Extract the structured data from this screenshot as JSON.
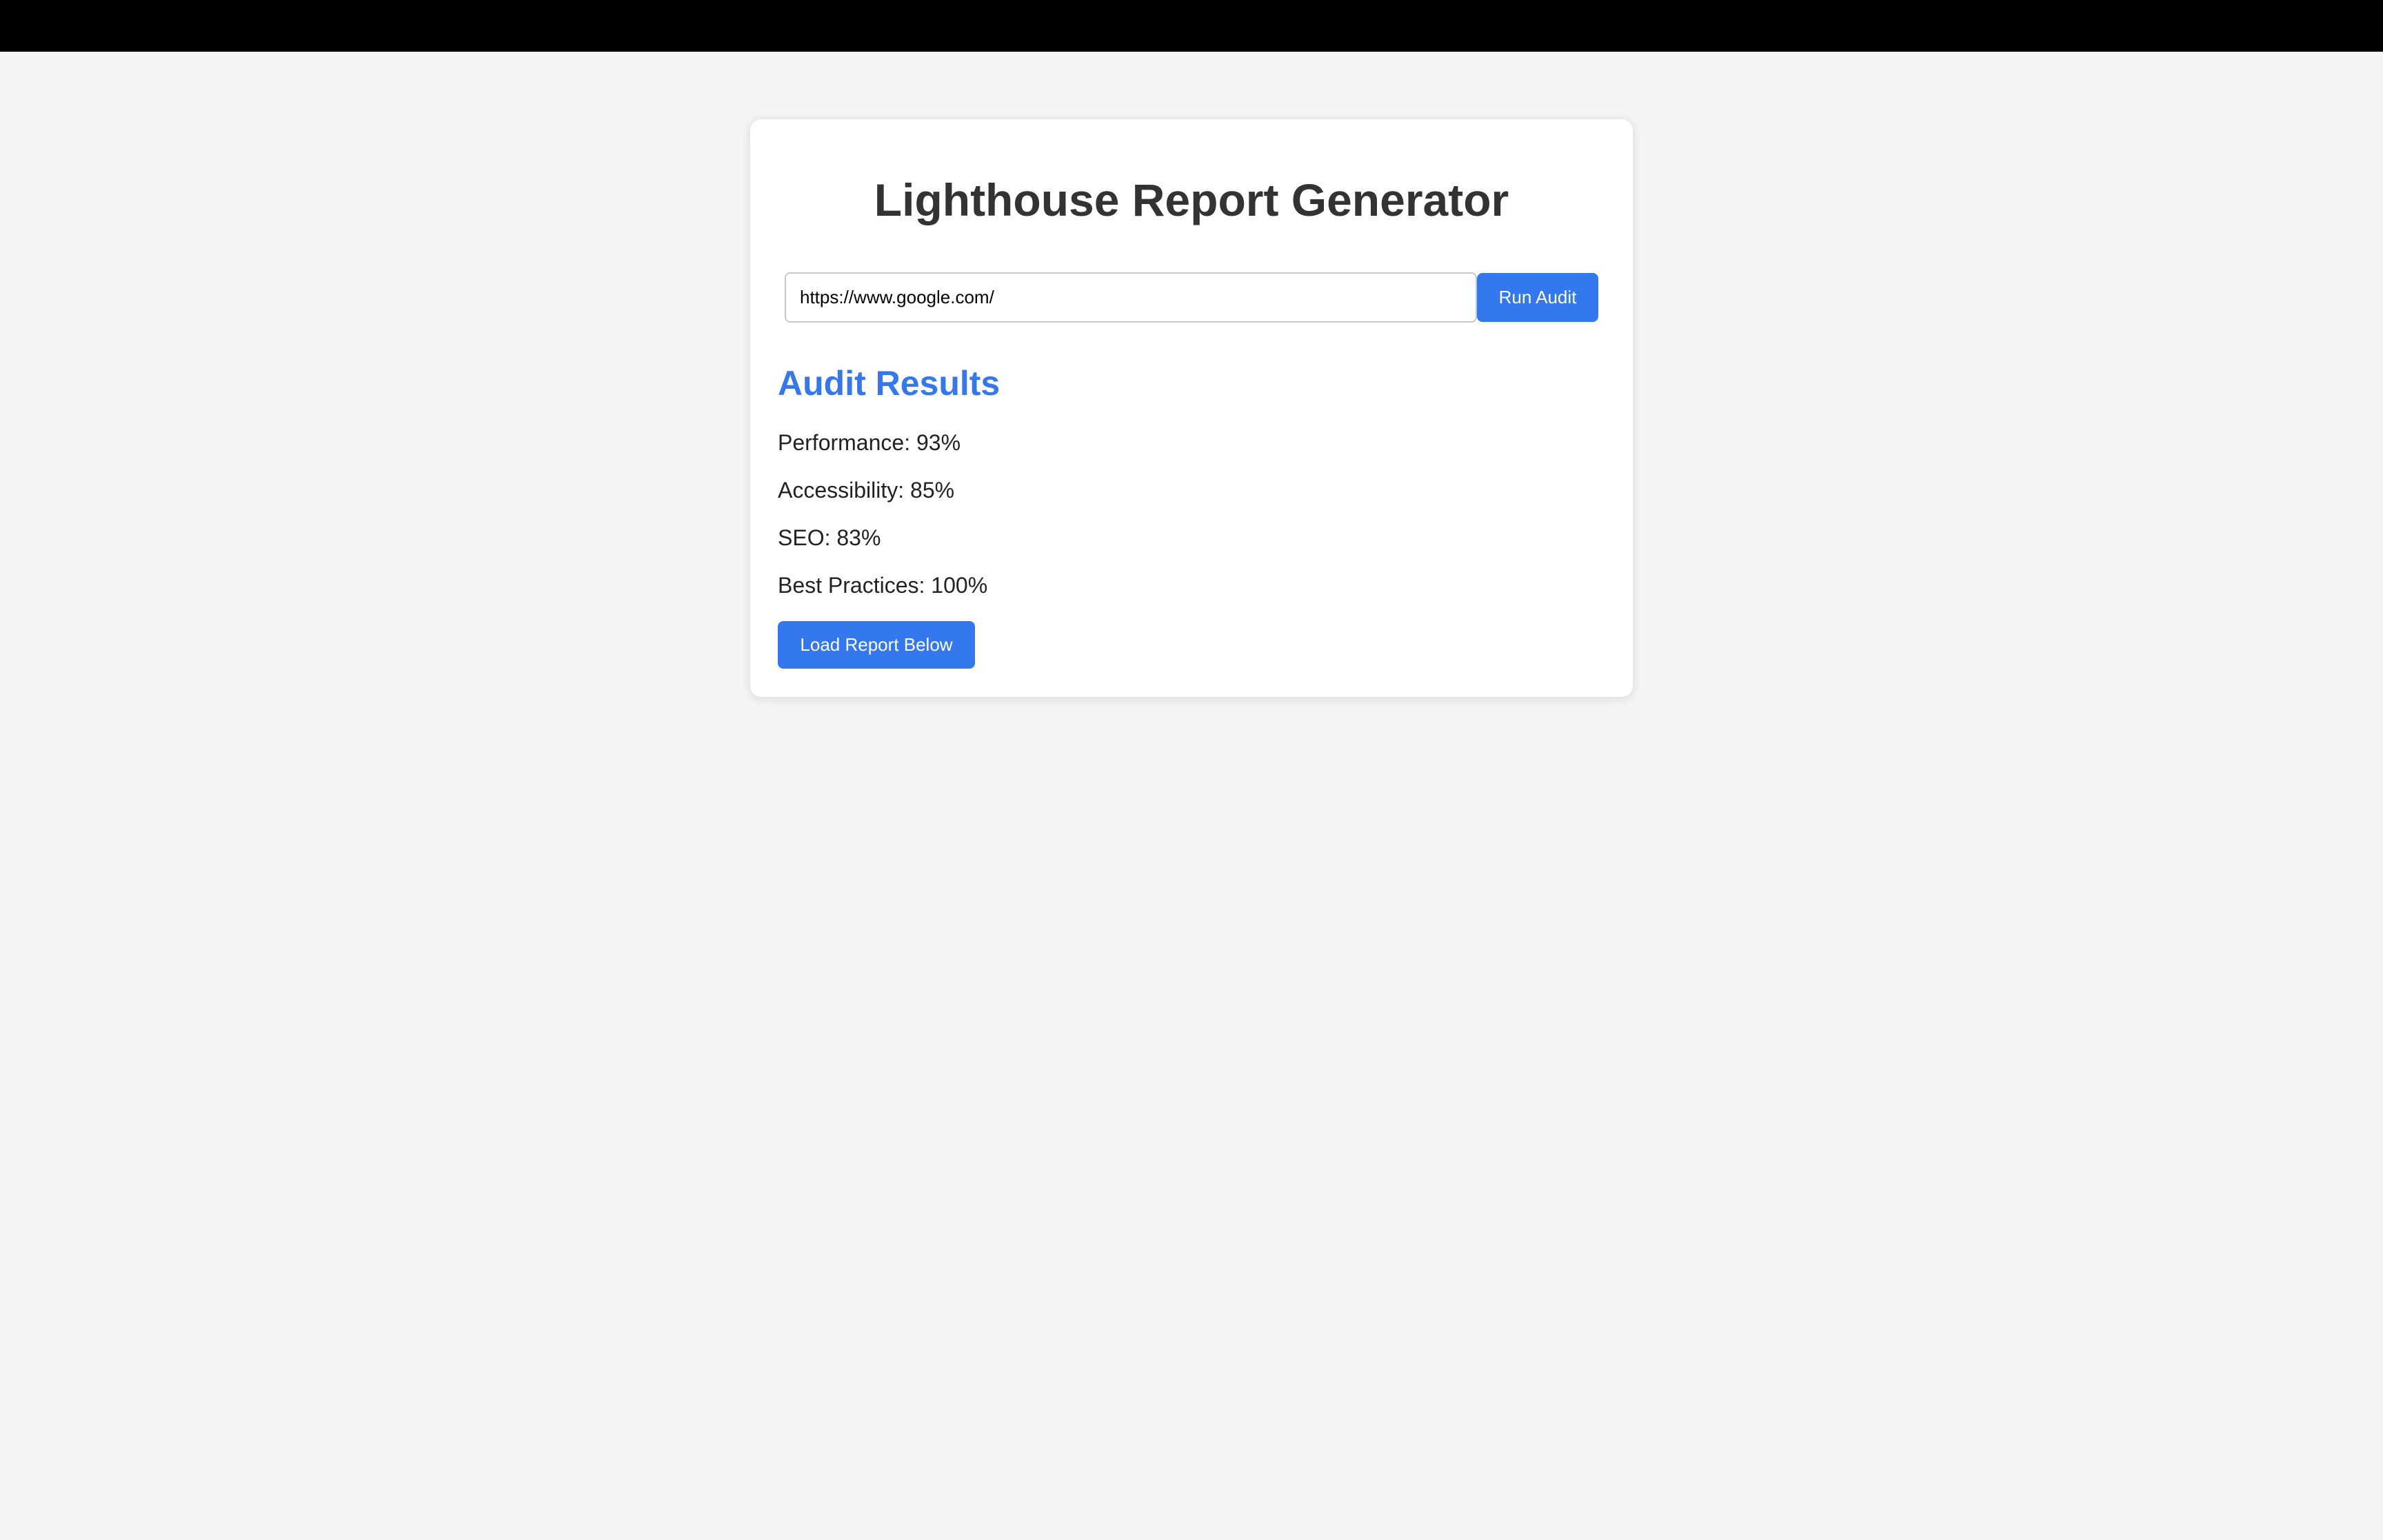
{
  "page": {
    "title": "Lighthouse Report Generator"
  },
  "audit_form": {
    "url_value": "https://www.google.com/",
    "run_button_label": "Run Audit"
  },
  "results": {
    "heading": "Audit Results",
    "items": [
      {
        "label": "Performance: 93%"
      },
      {
        "label": "Accessibility: 85%"
      },
      {
        "label": "SEO: 83%"
      },
      {
        "label": "Best Practices: 100%"
      }
    ],
    "load_button_label": "Load Report Below"
  },
  "colors": {
    "accent": "#3478f0",
    "background": "#f4f4f4",
    "top_bar": "#000000",
    "card": "#ffffff",
    "title_text": "#333333"
  }
}
